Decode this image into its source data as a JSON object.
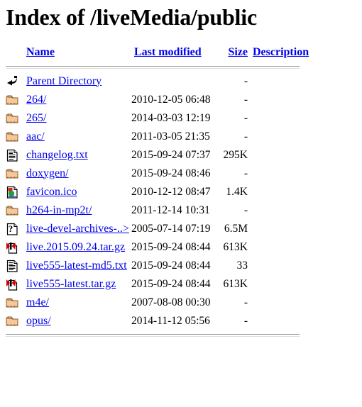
{
  "page": {
    "title": "Index of /liveMedia/public"
  },
  "table": {
    "headers": [
      {
        "label": "Name",
        "name": "sort-by-name"
      },
      {
        "label": "Last modified",
        "name": "sort-by-last-modified"
      },
      {
        "label": "Size",
        "name": "sort-by-size"
      },
      {
        "label": "Description",
        "name": "sort-by-description"
      }
    ],
    "rows": [
      {
        "icon": "parent-directory-icon",
        "name": "Parent Directory",
        "modified": "",
        "size": "-",
        "description": ""
      },
      {
        "icon": "folder-icon",
        "name": "264/",
        "modified": "2010-12-05 06:48",
        "size": "-",
        "description": ""
      },
      {
        "icon": "folder-icon",
        "name": "265/",
        "modified": "2014-03-03 12:19",
        "size": "-",
        "description": ""
      },
      {
        "icon": "folder-icon",
        "name": "aac/",
        "modified": "2011-03-05 21:35",
        "size": "-",
        "description": ""
      },
      {
        "icon": "text-file-icon",
        "name": "changelog.txt",
        "modified": "2015-09-24 07:37",
        "size": "295K",
        "description": ""
      },
      {
        "icon": "folder-icon",
        "name": "doxygen/",
        "modified": "2015-09-24 08:46",
        "size": "-",
        "description": ""
      },
      {
        "icon": "image-file-icon",
        "name": "favicon.ico",
        "modified": "2010-12-12 08:47",
        "size": "1.4K",
        "description": ""
      },
      {
        "icon": "folder-icon",
        "name": "h264-in-mp2t/",
        "modified": "2011-12-14 10:31",
        "size": "-",
        "description": ""
      },
      {
        "icon": "unknown-file-icon",
        "name": "live-devel-archives-..>",
        "modified": "2005-07-14 07:19",
        "size": "6.5M",
        "description": ""
      },
      {
        "icon": "compressed-file-icon",
        "name": "live.2015.09.24.tar.gz",
        "modified": "2015-09-24 08:44",
        "size": "613K",
        "description": ""
      },
      {
        "icon": "text-file-icon",
        "name": "live555-latest-md5.txt",
        "modified": "2015-09-24 08:44",
        "size": "33",
        "description": ""
      },
      {
        "icon": "compressed-file-icon",
        "name": "live555-latest.tar.gz",
        "modified": "2015-09-24 08:44",
        "size": "613K",
        "description": ""
      },
      {
        "icon": "folder-icon",
        "name": "m4e/",
        "modified": "2007-08-08 00:30",
        "size": "-",
        "description": ""
      },
      {
        "icon": "folder-icon",
        "name": "opus/",
        "modified": "2014-11-12 05:56",
        "size": "-",
        "description": ""
      }
    ]
  },
  "colors": {
    "link": "#0000ee",
    "folder": "#f5c89a",
    "folder_outline": "#b5773a",
    "rule": "#9a9a9a",
    "text": "#000000"
  }
}
